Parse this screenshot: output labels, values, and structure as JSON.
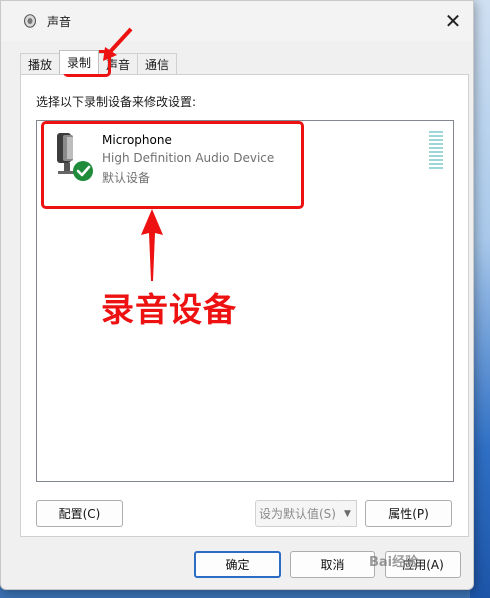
{
  "window": {
    "title": "声音",
    "close_glyph": "✕"
  },
  "tabs": [
    {
      "label": "播放",
      "active": false
    },
    {
      "label": "录制",
      "active": true
    },
    {
      "label": "声音",
      "active": false
    },
    {
      "label": "通信",
      "active": false
    }
  ],
  "recording": {
    "instruction": "选择以下录制设备来修改设置:",
    "device": {
      "name": "Microphone",
      "description": "High Definition Audio Device",
      "status": "默认设备",
      "icon": "microphone-icon",
      "badge_icon": "check-badge-icon"
    }
  },
  "annotation": {
    "label": "录音设备",
    "color": "#ee1111"
  },
  "buttons": {
    "configure": "配置(C)",
    "set_default": "设为默认值(S)",
    "properties": "属性(P)",
    "ok": "确定",
    "cancel": "取消",
    "apply": "应用(A)"
  },
  "watermark": "Bai经验",
  "colors": {
    "accent": "#2b6cc4",
    "check": "#1e8c3a",
    "level_meter": "#9fd6d9"
  }
}
